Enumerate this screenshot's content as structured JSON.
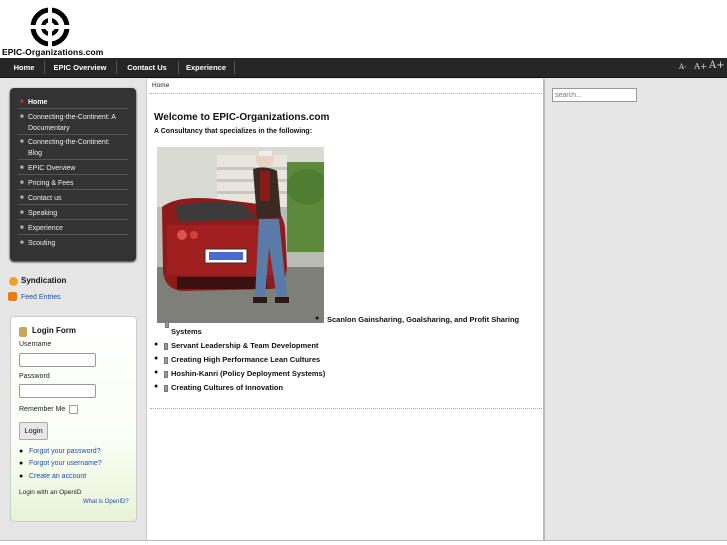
{
  "header": {
    "site_name": "EPIC-Organizations.com"
  },
  "topnav": {
    "items": [
      "Home",
      "EPIC Overview",
      "Contact Us",
      "Experience"
    ],
    "font_size_controls": [
      "A-",
      "A+",
      "A+"
    ]
  },
  "leftmenu": {
    "items": [
      "Home",
      "Connecting-the-Continent: A",
      "Documentary",
      "Connecting-the-Continent:",
      "Blog",
      "EPIC Overview",
      "Pricing & Fees",
      "Contact us",
      "Speaking",
      "Experience",
      "Scouting"
    ]
  },
  "syndication": {
    "title": "Syndication",
    "feed_link": "Feed Entries"
  },
  "login": {
    "title": "Login Form",
    "username_label": "Username",
    "password_label": "Password",
    "remember_label": "Remember Me",
    "button": "Login",
    "links": [
      "Forgot your password?",
      "Forgot your username?",
      "Create an account"
    ],
    "openid_label": "Login with an OpenID",
    "openid_link": "What is OpenID?"
  },
  "main": {
    "breadcrumb": "Home",
    "title": "Welcome to EPIC-Organizations.com",
    "subtitle": "A Consultancy that specializes in the following:",
    "list": [
      "Scanlon Gainsharing, Goalsharing, and Profit Sharing",
      "Systems",
      "Servant Leadership & Team Development",
      "Creating High Performance Lean Cultures",
      "Hoshin-Kanri (Policy Deployment Systems)",
      "Creating Cultures of Innovation"
    ]
  },
  "search": {
    "placeholder": "search..."
  },
  "colors": {
    "nav_bg": "#262626",
    "menu_bg": "#333333",
    "link": "#1a4fb0"
  }
}
